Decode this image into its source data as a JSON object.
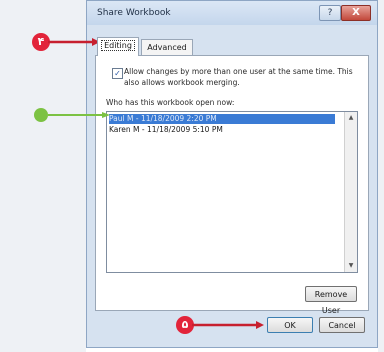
{
  "window": {
    "title": "Share Workbook",
    "help_label": "?",
    "close_label": "X"
  },
  "tabs": [
    {
      "label": "Editing",
      "active": true
    },
    {
      "label": "Advanced",
      "active": false
    }
  ],
  "editing": {
    "allow_changes_checked": true,
    "allow_changes_text": "Allow changes by more than one user at the same time. This also allows workbook merging.",
    "who_label": "Who has this workbook open now:",
    "users": [
      {
        "label": "Paul M - 11/18/2009 2:20 PM",
        "selected": true
      },
      {
        "label": "Karen M - 11/18/2009 5:10 PM",
        "selected": false
      }
    ],
    "remove_user_label": "Remove User"
  },
  "buttons": {
    "ok_label": "OK",
    "cancel_label": "Cancel"
  },
  "annotations": {
    "step_4": "۴",
    "step_5": "۵",
    "callout_color": "#e2243a",
    "arrow_color": "#c7202f",
    "pointer_color": "#7cc243"
  }
}
